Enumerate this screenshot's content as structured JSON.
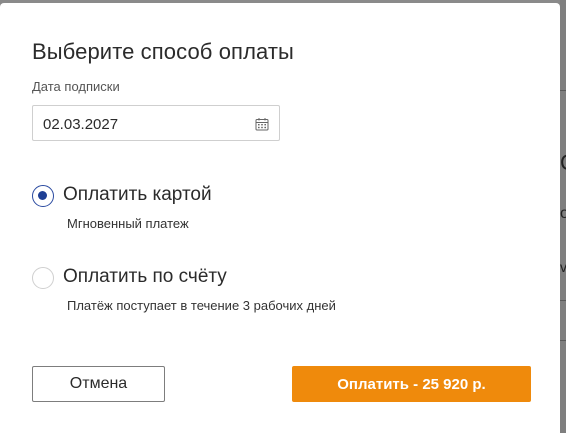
{
  "modal": {
    "title": "Выберите способ оплаты",
    "date_label": "Дата подписки",
    "date_value": "02.03.2027",
    "calendar_icon": "calendar-icon"
  },
  "payment_options": [
    {
      "label": "Оплатить картой",
      "description": "Мгновенный платеж",
      "selected": true
    },
    {
      "label": "Оплатить по счёту",
      "description": "Платёж поступает в течение 3 рабочих дней",
      "selected": false
    }
  ],
  "actions": {
    "cancel_label": "Отмена",
    "pay_label": "Оплатить - 25 920 р."
  },
  "colors": {
    "accent": "#ef8a0c",
    "radio_selected": "#1f3f94",
    "overlay": "#8a8a8a"
  }
}
